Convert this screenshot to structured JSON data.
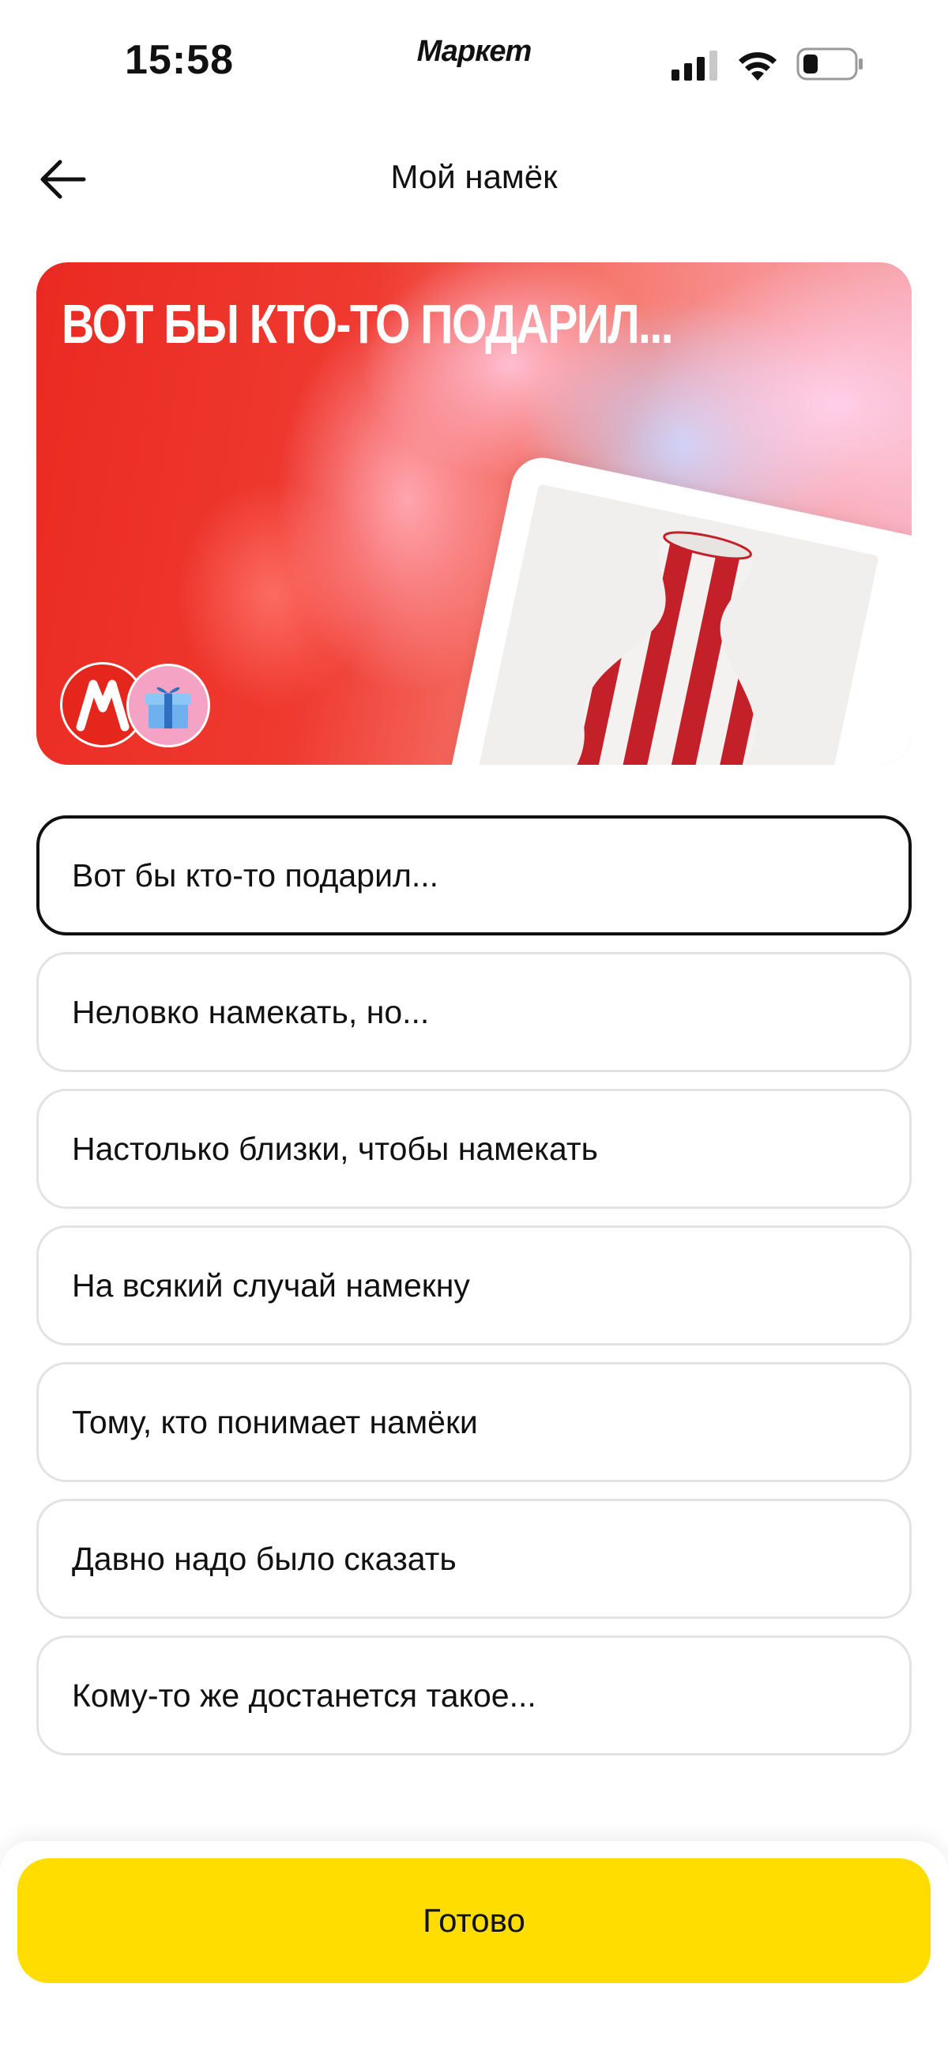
{
  "status_bar": {
    "time": "15:58",
    "carrier": "Маркет",
    "icons": [
      "signal-icon",
      "wifi-icon",
      "battery-icon"
    ]
  },
  "header": {
    "title": "Мой намёк",
    "back_icon": "arrow-left-icon"
  },
  "banner": {
    "title": "ВОТ БЫ КТО-ТО ПОДАРИЛ...",
    "background_color": "#ea2a22",
    "logo_letter": "М",
    "product_image": "striped-vase"
  },
  "options": [
    {
      "label": "Вот бы кто-то подарил...",
      "selected": true
    },
    {
      "label": "Неловко намекать, но...",
      "selected": false
    },
    {
      "label": "Настолько близки, чтобы намекать",
      "selected": false
    },
    {
      "label": "На всякий случай намекну",
      "selected": false
    },
    {
      "label": "Тому, кто понимает намёки",
      "selected": false
    },
    {
      "label": "Давно надо было сказать",
      "selected": false
    },
    {
      "label": "Кому-то же достанется такое...",
      "selected": false
    }
  ],
  "footer": {
    "done_label": "Готово",
    "accent_color": "#ffdd00"
  }
}
